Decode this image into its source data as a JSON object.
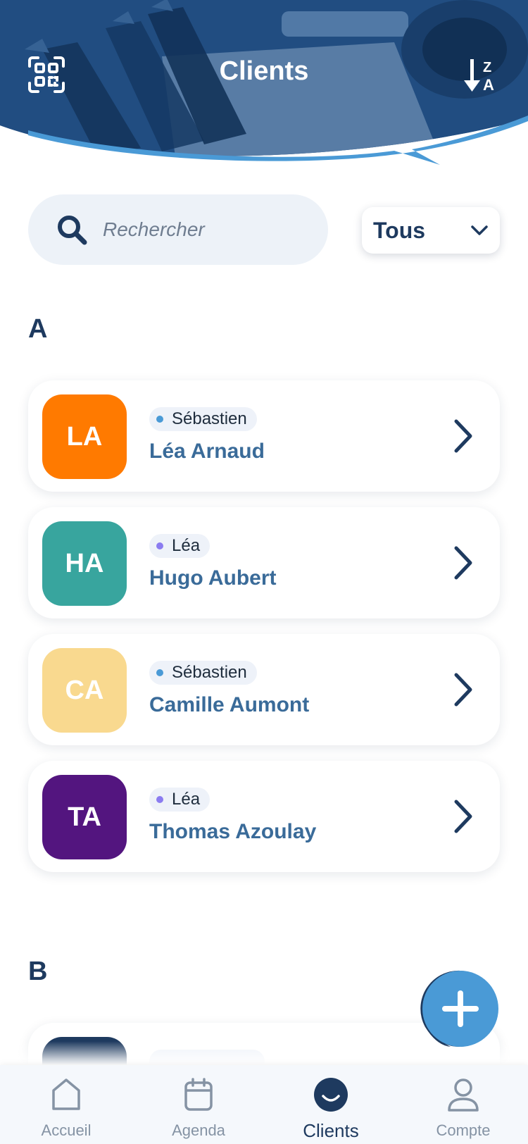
{
  "header": {
    "title": "Clients",
    "qr_icon": "qr-scan-icon",
    "sort_icon": "sort-z-a-icon"
  },
  "search": {
    "placeholder": "Rechercher"
  },
  "filter": {
    "selected": "Tous"
  },
  "sections": [
    {
      "letter": "A",
      "clients": [
        {
          "initials": "LA",
          "artist": "Sébastien",
          "name": "Léa Arnaud",
          "avatar_color": "#ff7a00",
          "dot_color": "#4a9ad6"
        },
        {
          "initials": "HA",
          "artist": "Léa",
          "name": "Hugo Aubert",
          "avatar_color": "#38a59e",
          "dot_color": "#8b7cf0"
        },
        {
          "initials": "CA",
          "artist": "Sébastien",
          "name": "Camille Aumont",
          "avatar_color": "#f9d98f",
          "dot_color": "#4a9ad6"
        },
        {
          "initials": "TA",
          "artist": "Léa",
          "name": "Thomas Azoulay",
          "avatar_color": "#53157f",
          "dot_color": "#8b7cf0"
        }
      ]
    },
    {
      "letter": "B",
      "clients": [
        {
          "initials": "",
          "artist": "",
          "name": "",
          "avatar_color": "#1e3a5f",
          "dot_color": "#4a9ad6"
        }
      ]
    }
  ],
  "fab": {
    "icon": "plus-icon"
  },
  "tabbar": {
    "tabs": [
      {
        "label": "Accueil",
        "icon": "home-icon"
      },
      {
        "label": "Agenda",
        "icon": "calendar-icon"
      },
      {
        "label": "Clients",
        "icon": "smile-icon",
        "active": true
      },
      {
        "label": "Compte",
        "icon": "user-icon"
      }
    ]
  },
  "colors": {
    "primary": "#1e3a5f",
    "accent": "#4a9ad6",
    "name_text": "#3a6b99"
  }
}
